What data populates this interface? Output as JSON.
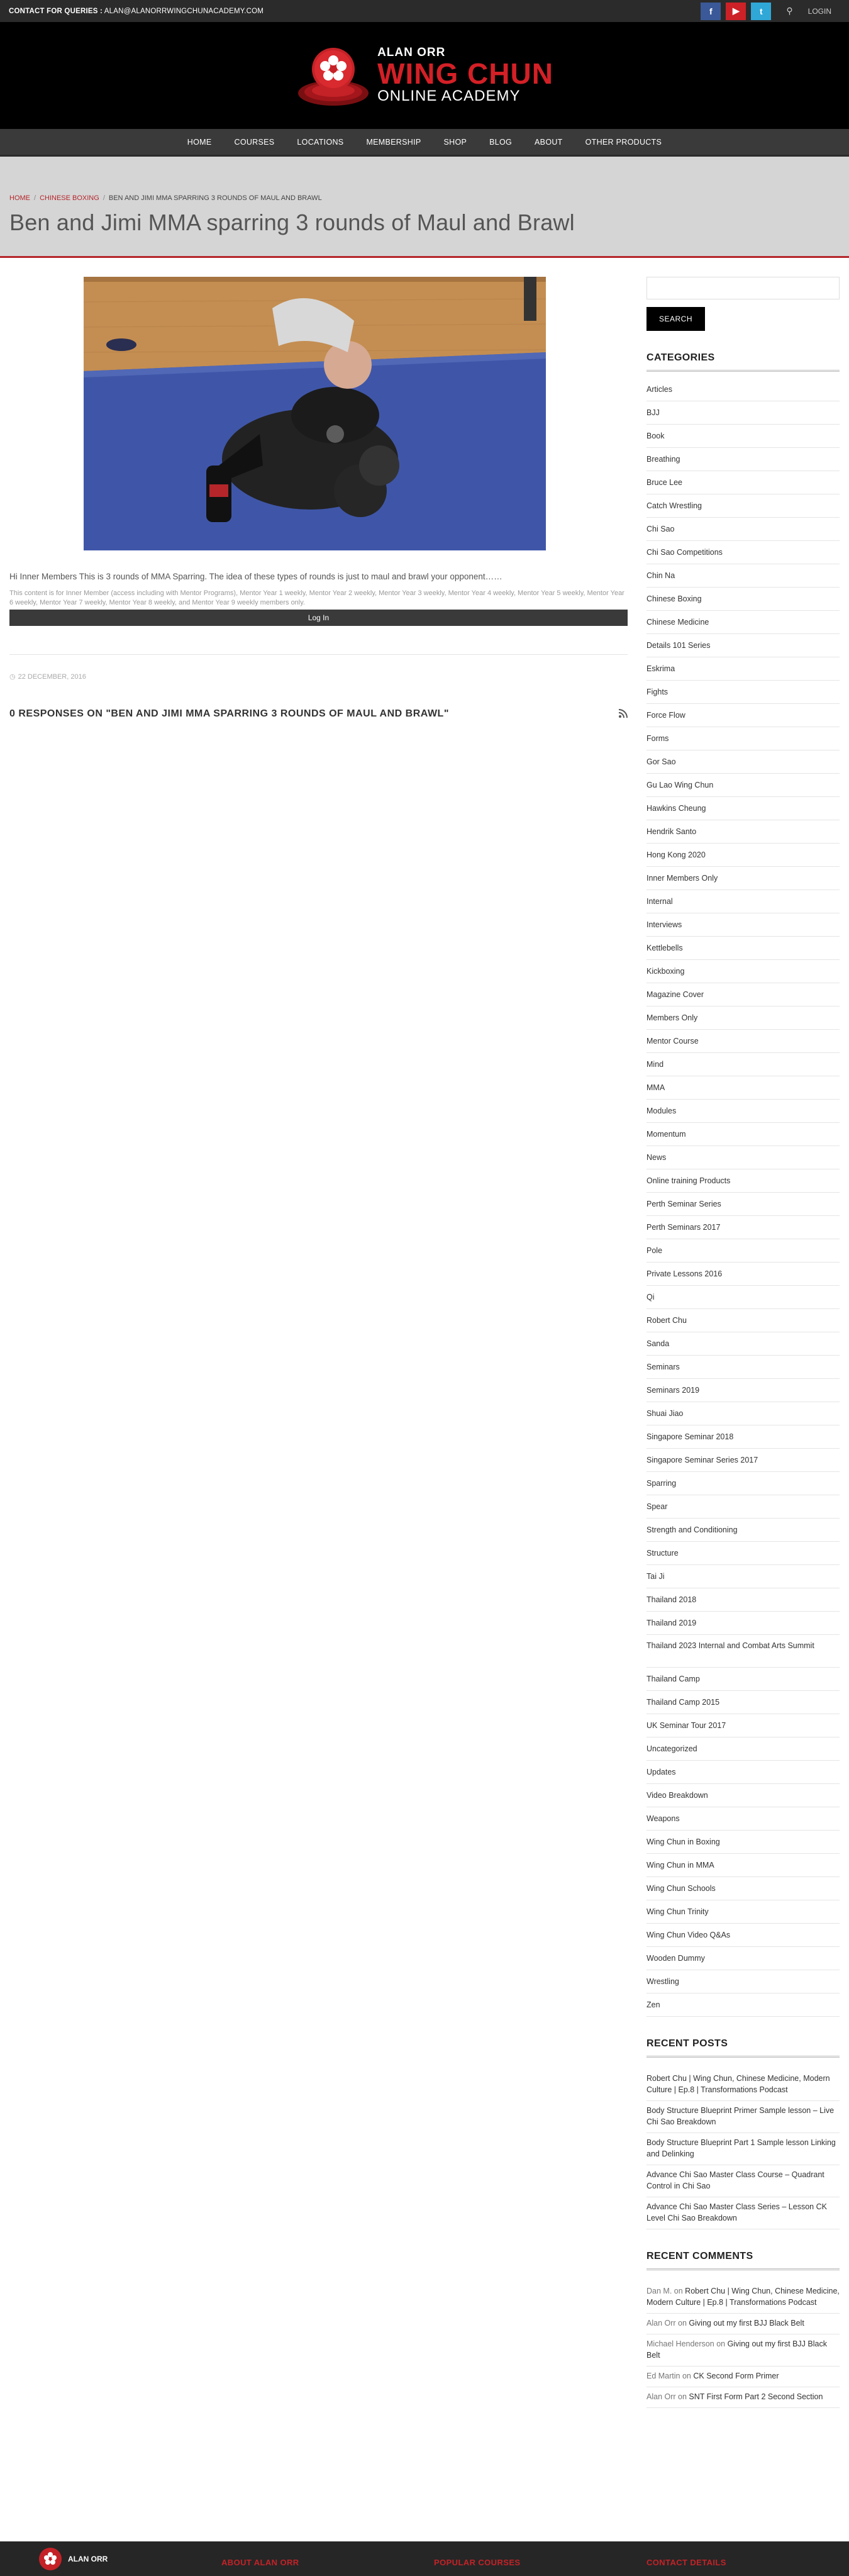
{
  "topbar": {
    "contact_label": "CONTACT FOR QUERIES :",
    "contact_email": "ALAN@ALANORRWINGCHUNACADEMY.COM",
    "facebook_glyph": "f",
    "youtube_glyph": "▶",
    "twitter_glyph": "t",
    "search_glyph": "⚲",
    "login_label": "LOGIN"
  },
  "logo": {
    "line1": "ALAN ORR",
    "line2": "WING CHUN",
    "line3": "ONLINE ACADEMY"
  },
  "nav": {
    "items": [
      "HOME",
      "COURSES",
      "LOCATIONS",
      "MEMBERSHIP",
      "SHOP",
      "BLOG",
      "ABOUT",
      "OTHER PRODUCTS"
    ]
  },
  "breadcrumb": {
    "home": "HOME",
    "category": "CHINESE BOXING",
    "current": "BEN AND JIMI MMA SPARRING 3 ROUNDS OF MAUL AND BRAWL"
  },
  "page": {
    "title": "Ben and Jimi MMA sparring 3 rounds of Maul and Brawl"
  },
  "post": {
    "intro": "Hi Inner Members This is 3 rounds of MMA Sparring. The idea of these types of rounds is just to maul and brawl your opponent……",
    "notice": "This content is for Inner Member (access including with Mentor Programs), Mentor Year 1 weekly, Mentor Year 2 weekly, Mentor Year 3 weekly, Mentor Year 4 weekly, Mentor Year 5 weekly, Mentor Year 6 weekly, Mentor Year 7 weekly, Mentor Year 8 weekly, and Mentor Year 9 weekly members only.",
    "login_button": "Log In",
    "date": "22 DECEMBER, 2016",
    "responses_heading": "0 RESPONSES ON \"BEN AND JIMI MMA SPARRING 3 ROUNDS OF MAUL AND BRAWL\""
  },
  "sidebar": {
    "search_button": "SEARCH",
    "categories_heading": "CATEGORIES",
    "categories": [
      "Articles",
      "BJJ",
      "Book",
      "Breathing",
      "Bruce Lee",
      "Catch Wrestling",
      "Chi Sao",
      "Chi Sao Competitions",
      "Chin Na",
      "Chinese Boxing",
      "Chinese Medicine",
      "Details 101 Series",
      "Eskrima",
      "Fights",
      "Force Flow",
      "Forms",
      "Gor Sao",
      "Gu Lao Wing Chun",
      "Hawkins Cheung",
      "Hendrik Santo",
      "Hong Kong 2020",
      "Inner Members Only",
      "Internal",
      "Interviews",
      "Kettlebells",
      "Kickboxing",
      "Magazine Cover",
      "Members Only",
      "Mentor Course",
      "Mind",
      "MMA",
      "Modules",
      "Momentum",
      "News",
      "Online training Products",
      "Perth Seminar Series",
      "Perth Seminars 2017",
      "Pole",
      "Private Lessons 2016",
      "Qi",
      "Robert Chu",
      "Sanda",
      "Seminars",
      "Seminars 2019",
      "Shuai Jiao",
      "Singapore Seminar 2018",
      "Singapore Seminar Series 2017",
      "Sparring",
      "Spear",
      "Strength and Conditioning",
      "Structure",
      "Tai Ji",
      "Thailand 2018",
      "Thailand 2019",
      "Thailand 2023 Internal and Combat Arts Summit",
      "Thailand Camp",
      "Thailand Camp 2015",
      "UK Seminar Tour 2017",
      "Uncategorized",
      "Updates",
      "Video Breakdown",
      "Weapons",
      "Wing Chun in Boxing",
      "Wing Chun in MMA",
      "Wing Chun Schools",
      "Wing Chun Trinity",
      "Wing Chun Video Q&As",
      "Wooden Dummy",
      "Wrestling",
      "Zen"
    ],
    "recent_posts_heading": "RECENT POSTS",
    "recent_posts": [
      "Robert Chu | Wing Chun, Chinese Medicine, Modern Culture | Ep.8 | Transformations Podcast",
      "Body Structure Blueprint Primer Sample lesson – Live Chi Sao Breakdown",
      "Body Structure Blueprint Part 1 Sample lesson Linking and Delinking",
      "Advance Chi Sao Master Class Course – Quadrant Control in Chi Sao",
      "Advance Chi Sao Master Class Series – Lesson CK Level Chi Sao Breakdown"
    ],
    "recent_comments_heading": "RECENT COMMENTS",
    "on_word": "on",
    "recent_comments": [
      {
        "author": "Dan M.",
        "post": "Robert Chu | Wing Chun, Chinese Medicine, Modern Culture | Ep.8 | Transformations Podcast"
      },
      {
        "author": "Alan Orr",
        "post": "Giving out my first BJJ Black Belt"
      },
      {
        "author": "Michael Henderson",
        "post": "Giving out my first BJJ Black Belt"
      },
      {
        "author": "Ed Martin",
        "post": "CK Second Form Primer"
      },
      {
        "author": "Alan Orr",
        "post": "SNT First Form Part 2 Second Section"
      }
    ]
  },
  "footer": {
    "logo_text": "ALAN ORR",
    "col1": "ABOUT ALAN ORR",
    "col2": "POPULAR COURSES",
    "col3": "CONTACT DETAILS"
  },
  "colors": {
    "accent": "#b5262b",
    "topbar": "#2b2b2b",
    "nav": "#3a3a3a",
    "titleband": "#d5d5d5"
  }
}
